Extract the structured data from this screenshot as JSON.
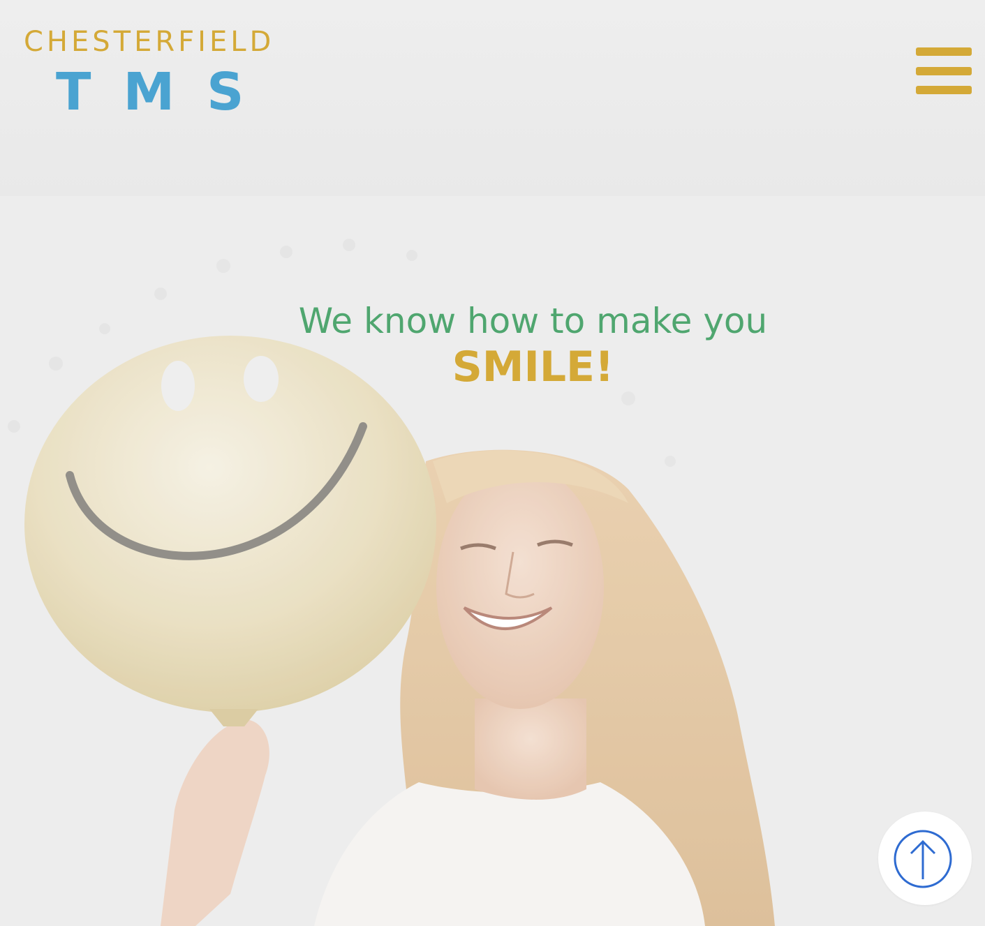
{
  "header": {
    "logo": {
      "line1": "CHESTERFIELD",
      "line2": "TMS"
    },
    "menu_icon": "hamburger-menu-icon"
  },
  "hero": {
    "headline": "We know how to make you",
    "emphasis": "SMILE!",
    "background": "woman-with-smiley-balloon-photo"
  },
  "scroll_top": {
    "icon": "arrow-up-circle-icon"
  },
  "colors": {
    "gold": "#D4A937",
    "blue": "#4AA3D1",
    "green": "#4FA66F",
    "scroll_icon": "#2E6BD1"
  }
}
